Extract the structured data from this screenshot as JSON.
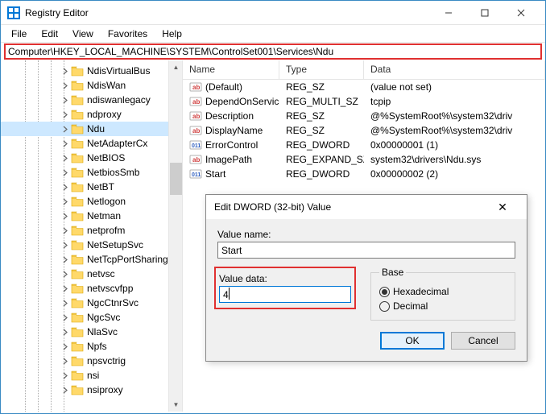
{
  "window": {
    "title": "Registry Editor",
    "min_icon": "minimize-icon",
    "max_icon": "maximize-icon",
    "close_icon": "close-icon"
  },
  "menu": [
    "File",
    "Edit",
    "View",
    "Favorites",
    "Help"
  ],
  "address": "Computer\\HKEY_LOCAL_MACHINE\\SYSTEM\\ControlSet001\\Services\\Ndu",
  "tree": [
    {
      "label": "NdisVirtualBus",
      "selected": false
    },
    {
      "label": "NdisWan",
      "selected": false
    },
    {
      "label": "ndiswanlegacy",
      "selected": false
    },
    {
      "label": "ndproxy",
      "selected": false
    },
    {
      "label": "Ndu",
      "selected": true
    },
    {
      "label": "NetAdapterCx",
      "selected": false
    },
    {
      "label": "NetBIOS",
      "selected": false
    },
    {
      "label": "NetbiosSmb",
      "selected": false
    },
    {
      "label": "NetBT",
      "selected": false
    },
    {
      "label": "Netlogon",
      "selected": false
    },
    {
      "label": "Netman",
      "selected": false
    },
    {
      "label": "netprofm",
      "selected": false
    },
    {
      "label": "NetSetupSvc",
      "selected": false
    },
    {
      "label": "NetTcpPortSharing",
      "selected": false
    },
    {
      "label": "netvsc",
      "selected": false
    },
    {
      "label": "netvscvfpp",
      "selected": false
    },
    {
      "label": "NgcCtnrSvc",
      "selected": false
    },
    {
      "label": "NgcSvc",
      "selected": false
    },
    {
      "label": "NlaSvc",
      "selected": false
    },
    {
      "label": "Npfs",
      "selected": false
    },
    {
      "label": "npsvctrig",
      "selected": false
    },
    {
      "label": "nsi",
      "selected": false
    },
    {
      "label": "nsiproxy",
      "selected": false
    }
  ],
  "list": {
    "headers": {
      "name": "Name",
      "type": "Type",
      "data": "Data"
    },
    "rows": [
      {
        "icon": "string",
        "name": "(Default)",
        "type": "REG_SZ",
        "data": "(value not set)"
      },
      {
        "icon": "string",
        "name": "DependOnService",
        "type": "REG_MULTI_SZ",
        "data": "tcpip"
      },
      {
        "icon": "string",
        "name": "Description",
        "type": "REG_SZ",
        "data": "@%SystemRoot%\\system32\\driv"
      },
      {
        "icon": "string",
        "name": "DisplayName",
        "type": "REG_SZ",
        "data": "@%SystemRoot%\\system32\\driv"
      },
      {
        "icon": "bin",
        "name": "ErrorControl",
        "type": "REG_DWORD",
        "data": "0x00000001 (1)"
      },
      {
        "icon": "string",
        "name": "ImagePath",
        "type": "REG_EXPAND_SZ",
        "data": "system32\\drivers\\Ndu.sys"
      },
      {
        "icon": "bin",
        "name": "Start",
        "type": "REG_DWORD",
        "data": "0x00000002 (2)"
      }
    ]
  },
  "dialog": {
    "title": "Edit DWORD (32-bit) Value",
    "value_name_label": "Value name:",
    "value_name": "Start",
    "value_data_label": "Value data:",
    "value_data": "4",
    "base_label": "Base",
    "hex_label": "Hexadecimal",
    "dec_label": "Decimal",
    "base_selected": "hex",
    "ok": "OK",
    "cancel": "Cancel"
  }
}
